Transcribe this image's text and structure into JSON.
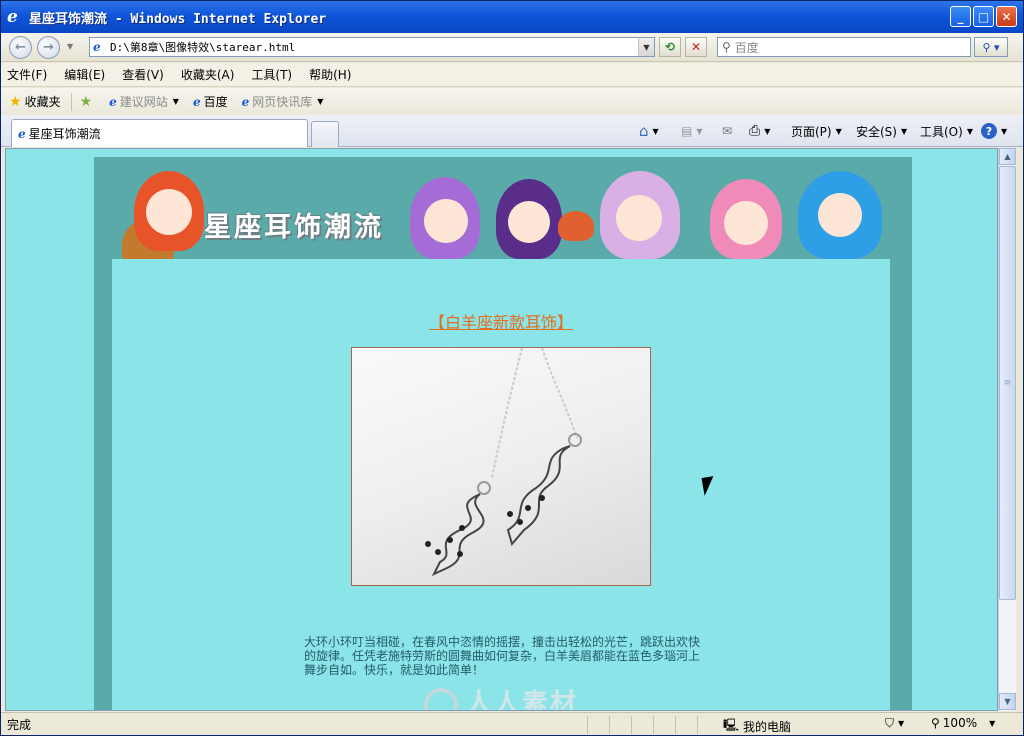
{
  "window": {
    "title": "星座耳饰潮流 - Windows Internet Explorer"
  },
  "address": {
    "url": "D:\\第8章\\图像特效\\starear.html"
  },
  "search": {
    "placeholder": "百度"
  },
  "menu": [
    "文件(F)",
    "编辑(E)",
    "查看(V)",
    "收藏夹(A)",
    "工具(T)",
    "帮助(H)"
  ],
  "favorites": {
    "label": "收藏夹",
    "items": [
      "建议网站",
      "百度",
      "网页快讯库"
    ]
  },
  "tab": {
    "title": "星座耳饰潮流"
  },
  "commands": {
    "page": "页面(P)",
    "safety": "安全(S)",
    "tools": "工具(O)"
  },
  "content": {
    "banner_title": "星座耳饰潮流",
    "product_title": "【白羊座新款耳饰】",
    "description": "大环小环叮当相碰，在春风中恣情的摇摆，撞击出轻松的光芒，跳跃出欢快的旋律。任凭老施特劳斯的圆舞曲如何复杂，白羊美眉都能在蓝色多瑙河上舞步自如。快乐，就是如此简单！",
    "watermark": "人人素材"
  },
  "status": {
    "text": "完成",
    "zone": "我的电脑",
    "zoom": "100%"
  }
}
